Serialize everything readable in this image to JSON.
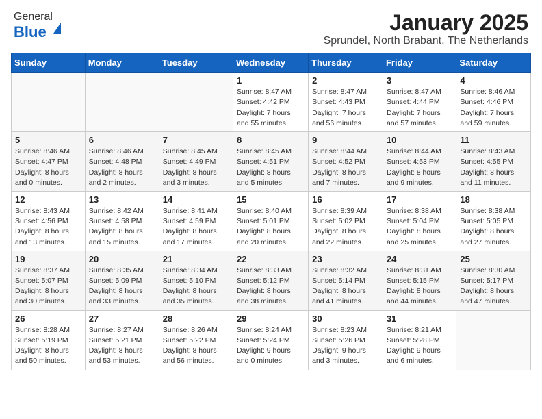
{
  "header": {
    "logo_general": "General",
    "logo_blue": "Blue",
    "title": "January 2025",
    "subtitle": "Sprundel, North Brabant, The Netherlands"
  },
  "calendar": {
    "days_of_week": [
      "Sunday",
      "Monday",
      "Tuesday",
      "Wednesday",
      "Thursday",
      "Friday",
      "Saturday"
    ],
    "weeks": [
      {
        "cells": [
          {
            "day": "",
            "info": ""
          },
          {
            "day": "",
            "info": ""
          },
          {
            "day": "",
            "info": ""
          },
          {
            "day": "1",
            "info": "Sunrise: 8:47 AM\nSunset: 4:42 PM\nDaylight: 7 hours\nand 55 minutes."
          },
          {
            "day": "2",
            "info": "Sunrise: 8:47 AM\nSunset: 4:43 PM\nDaylight: 7 hours\nand 56 minutes."
          },
          {
            "day": "3",
            "info": "Sunrise: 8:47 AM\nSunset: 4:44 PM\nDaylight: 7 hours\nand 57 minutes."
          },
          {
            "day": "4",
            "info": "Sunrise: 8:46 AM\nSunset: 4:46 PM\nDaylight: 7 hours\nand 59 minutes."
          }
        ]
      },
      {
        "cells": [
          {
            "day": "5",
            "info": "Sunrise: 8:46 AM\nSunset: 4:47 PM\nDaylight: 8 hours\nand 0 minutes."
          },
          {
            "day": "6",
            "info": "Sunrise: 8:46 AM\nSunset: 4:48 PM\nDaylight: 8 hours\nand 2 minutes."
          },
          {
            "day": "7",
            "info": "Sunrise: 8:45 AM\nSunset: 4:49 PM\nDaylight: 8 hours\nand 3 minutes."
          },
          {
            "day": "8",
            "info": "Sunrise: 8:45 AM\nSunset: 4:51 PM\nDaylight: 8 hours\nand 5 minutes."
          },
          {
            "day": "9",
            "info": "Sunrise: 8:44 AM\nSunset: 4:52 PM\nDaylight: 8 hours\nand 7 minutes."
          },
          {
            "day": "10",
            "info": "Sunrise: 8:44 AM\nSunset: 4:53 PM\nDaylight: 8 hours\nand 9 minutes."
          },
          {
            "day": "11",
            "info": "Sunrise: 8:43 AM\nSunset: 4:55 PM\nDaylight: 8 hours\nand 11 minutes."
          }
        ]
      },
      {
        "cells": [
          {
            "day": "12",
            "info": "Sunrise: 8:43 AM\nSunset: 4:56 PM\nDaylight: 8 hours\nand 13 minutes."
          },
          {
            "day": "13",
            "info": "Sunrise: 8:42 AM\nSunset: 4:58 PM\nDaylight: 8 hours\nand 15 minutes."
          },
          {
            "day": "14",
            "info": "Sunrise: 8:41 AM\nSunset: 4:59 PM\nDaylight: 8 hours\nand 17 minutes."
          },
          {
            "day": "15",
            "info": "Sunrise: 8:40 AM\nSunset: 5:01 PM\nDaylight: 8 hours\nand 20 minutes."
          },
          {
            "day": "16",
            "info": "Sunrise: 8:39 AM\nSunset: 5:02 PM\nDaylight: 8 hours\nand 22 minutes."
          },
          {
            "day": "17",
            "info": "Sunrise: 8:38 AM\nSunset: 5:04 PM\nDaylight: 8 hours\nand 25 minutes."
          },
          {
            "day": "18",
            "info": "Sunrise: 8:38 AM\nSunset: 5:05 PM\nDaylight: 8 hours\nand 27 minutes."
          }
        ]
      },
      {
        "cells": [
          {
            "day": "19",
            "info": "Sunrise: 8:37 AM\nSunset: 5:07 PM\nDaylight: 8 hours\nand 30 minutes."
          },
          {
            "day": "20",
            "info": "Sunrise: 8:35 AM\nSunset: 5:09 PM\nDaylight: 8 hours\nand 33 minutes."
          },
          {
            "day": "21",
            "info": "Sunrise: 8:34 AM\nSunset: 5:10 PM\nDaylight: 8 hours\nand 35 minutes."
          },
          {
            "day": "22",
            "info": "Sunrise: 8:33 AM\nSunset: 5:12 PM\nDaylight: 8 hours\nand 38 minutes."
          },
          {
            "day": "23",
            "info": "Sunrise: 8:32 AM\nSunset: 5:14 PM\nDaylight: 8 hours\nand 41 minutes."
          },
          {
            "day": "24",
            "info": "Sunrise: 8:31 AM\nSunset: 5:15 PM\nDaylight: 8 hours\nand 44 minutes."
          },
          {
            "day": "25",
            "info": "Sunrise: 8:30 AM\nSunset: 5:17 PM\nDaylight: 8 hours\nand 47 minutes."
          }
        ]
      },
      {
        "cells": [
          {
            "day": "26",
            "info": "Sunrise: 8:28 AM\nSunset: 5:19 PM\nDaylight: 8 hours\nand 50 minutes."
          },
          {
            "day": "27",
            "info": "Sunrise: 8:27 AM\nSunset: 5:21 PM\nDaylight: 8 hours\nand 53 minutes."
          },
          {
            "day": "28",
            "info": "Sunrise: 8:26 AM\nSunset: 5:22 PM\nDaylight: 8 hours\nand 56 minutes."
          },
          {
            "day": "29",
            "info": "Sunrise: 8:24 AM\nSunset: 5:24 PM\nDaylight: 9 hours\nand 0 minutes."
          },
          {
            "day": "30",
            "info": "Sunrise: 8:23 AM\nSunset: 5:26 PM\nDaylight: 9 hours\nand 3 minutes."
          },
          {
            "day": "31",
            "info": "Sunrise: 8:21 AM\nSunset: 5:28 PM\nDaylight: 9 hours\nand 6 minutes."
          },
          {
            "day": "",
            "info": ""
          }
        ]
      }
    ]
  }
}
